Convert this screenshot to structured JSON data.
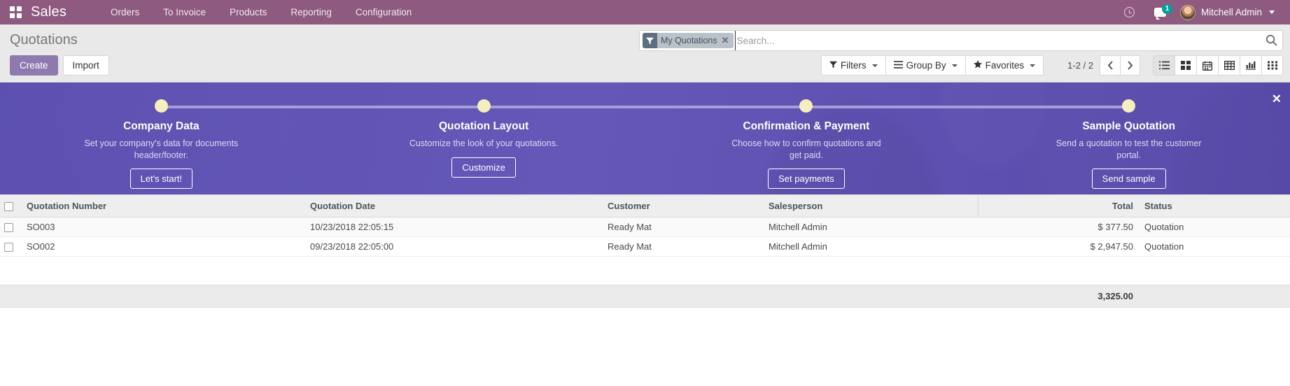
{
  "navbar": {
    "apps_icon": "apps-grid-icon",
    "brand": "Sales",
    "menu": [
      {
        "label": "Orders"
      },
      {
        "label": "To Invoice"
      },
      {
        "label": "Products"
      },
      {
        "label": "Reporting"
      },
      {
        "label": "Configuration"
      }
    ],
    "activity_icon": "clock-icon",
    "messages_icon": "chat-icon",
    "messages_count": "1",
    "avatar_icon": "user-avatar",
    "user_name": "Mitchell Admin",
    "user_caret_icon": "caret-down-icon"
  },
  "control_panel": {
    "breadcrumb": "Quotations",
    "create_label": "Create",
    "import_label": "Import",
    "search": {
      "facet_icon": "filter-icon",
      "facet_label": "My Quotations",
      "facet_remove_icon": "close-icon",
      "placeholder": "Search...",
      "value": "",
      "search_icon": "search-icon"
    },
    "dropdowns": [
      {
        "label": "Filters",
        "icon": "filter-icon"
      },
      {
        "label": "Group By",
        "icon": "hamburger-icon"
      },
      {
        "label": "Favorites",
        "icon": "star-icon"
      }
    ],
    "pager": {
      "range": "1-2 / 2",
      "prev_icon": "chevron-left-icon",
      "next_icon": "chevron-right-icon"
    },
    "views": [
      {
        "name": "list",
        "icon": "list-view-icon",
        "active": true
      },
      {
        "name": "kanban",
        "icon": "kanban-view-icon",
        "active": false
      },
      {
        "name": "calendar",
        "icon": "calendar-view-icon",
        "active": false
      },
      {
        "name": "pivot",
        "icon": "pivot-view-icon",
        "active": false
      },
      {
        "name": "graph",
        "icon": "graph-view-icon",
        "active": false
      },
      {
        "name": "activity",
        "icon": "activity-view-icon",
        "active": false
      }
    ]
  },
  "banner": {
    "close_icon": "close-icon",
    "steps": [
      {
        "title": "Company Data",
        "description": "Set your company's data for documents header/footer.",
        "button": "Let's start!"
      },
      {
        "title": "Quotation Layout",
        "description": "Customize the look of your quotations.",
        "button": "Customize"
      },
      {
        "title": "Confirmation & Payment",
        "description": "Choose how to confirm quotations and get paid.",
        "button": "Set payments"
      },
      {
        "title": "Sample Quotation",
        "description": "Send a quotation to test the customer portal.",
        "button": "Send sample"
      }
    ]
  },
  "list": {
    "columns": [
      "Quotation Number",
      "Quotation Date",
      "Customer",
      "Salesperson",
      "Total",
      "Status"
    ],
    "rows": [
      {
        "number": "SO003",
        "date": "10/23/2018 22:05:15",
        "customer": "Ready Mat",
        "salesperson": "Mitchell Admin",
        "total": "$ 377.50",
        "status": "Quotation"
      },
      {
        "number": "SO002",
        "date": "09/23/2018 22:05:00",
        "customer": "Ready Mat",
        "salesperson": "Mitchell Admin",
        "total": "$ 2,947.50",
        "status": "Quotation"
      }
    ],
    "footer_total": "3,325.00"
  },
  "colors": {
    "navbar": "#8e5a80",
    "primary": "#8f7ab0",
    "banner": "#5f53b0",
    "dot": "#f5eebe",
    "badge": "#00a09d"
  }
}
